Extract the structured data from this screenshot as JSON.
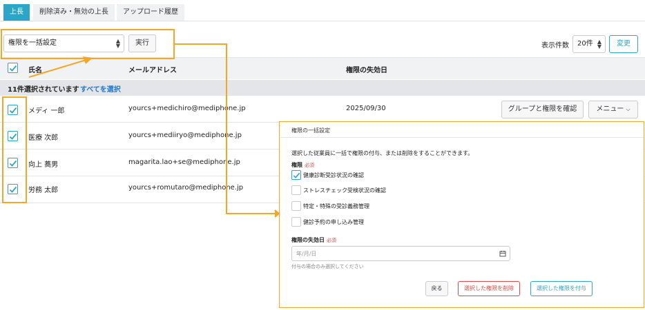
{
  "tabs": [
    {
      "label": "上長",
      "active": true
    },
    {
      "label": "削除済み・無効の上長",
      "active": false
    },
    {
      "label": "アップロード履歴",
      "active": false
    }
  ],
  "bulk": {
    "select_value": "権限を一括設定",
    "run_label": "実行"
  },
  "pagination": {
    "count_label": "表示件数",
    "count_value": "20件",
    "change_label": "変更"
  },
  "table": {
    "headers": {
      "name": "氏名",
      "email": "メールアドレス",
      "expiry": "権限の失効日"
    },
    "selection_text": "11件選択されています",
    "select_all_link": "すべてを選択",
    "rows": [
      {
        "name": "メディ 一郎",
        "email": "yourcs+medichiro@mediphone.jp",
        "expiry": "2025/09/30",
        "checked": true
      },
      {
        "name": "医療 次郎",
        "email": "yourcs+mediiryo@mediphone.jp",
        "expiry": "",
        "checked": true
      },
      {
        "name": "向上 蕎男",
        "email": "magarita.lao+se@mediphone.jp",
        "expiry": "",
        "checked": true
      },
      {
        "name": "労務 太郎",
        "email": "yourcs+romutaro@mediphone.jp",
        "expiry": "",
        "checked": true
      }
    ],
    "row_actions": {
      "group_button": "グループと権限を確認",
      "menu_button": "メニュー"
    }
  },
  "modal": {
    "title": "権限の一括設定",
    "description": "選択した従業員に一括で権限の付与、または削除をすることができます。",
    "permissions_label": "権限",
    "required": "必須",
    "permissions": [
      {
        "label": "健康診断受診状況の確認",
        "checked": true
      },
      {
        "label": "ストレスチェック受検状況の確認",
        "checked": false
      },
      {
        "label": "特定・特殊の受診義務管理",
        "checked": false
      },
      {
        "label": "健診予約の申し込み管理",
        "checked": false
      }
    ],
    "expiry_label": "権限の失効日",
    "date_placeholder": "年/月/日",
    "hint": "付与の場合のみ選択してください",
    "back_label": "戻る",
    "remove_label": "選択した権限を削除",
    "grant_label": "選択した権限を付与"
  },
  "colors": {
    "accent": "#2ba5c8",
    "highlight": "#f5a623",
    "danger": "#e04848",
    "link": "#2477c7"
  }
}
